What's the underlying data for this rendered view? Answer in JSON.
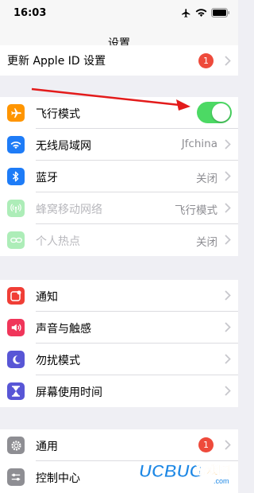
{
  "status_bar": {
    "time": "16:03"
  },
  "nav": {
    "title": "设置"
  },
  "top_item": {
    "label": "更新 Apple ID 设置",
    "badge": "1"
  },
  "group1": [
    {
      "id": "airplane",
      "label": "飞行模式",
      "value": "",
      "toggle_on": true,
      "icon": "airplane-icon",
      "color": "#ff9500",
      "disabled": false
    },
    {
      "id": "wifi",
      "label": "无线局域网",
      "value": "Jfchina",
      "icon": "wifi-icon",
      "color": "#1e7cf7",
      "disabled": false
    },
    {
      "id": "bluetooth",
      "label": "蓝牙",
      "value": "关闭",
      "icon": "bluetooth-icon",
      "color": "#1e7cf7",
      "disabled": false
    },
    {
      "id": "cellular",
      "label": "蜂窝移动网络",
      "value": "飞行模式",
      "icon": "cellular-icon",
      "color": "#4cd964",
      "disabled": true
    },
    {
      "id": "hotspot",
      "label": "个人热点",
      "value": "关闭",
      "icon": "hotspot-icon",
      "color": "#4cd964",
      "disabled": true
    }
  ],
  "group2": [
    {
      "id": "notifications",
      "label": "通知",
      "icon": "notifications-icon",
      "color": "#f03e36"
    },
    {
      "id": "sounds",
      "label": "声音与触感",
      "icon": "sounds-icon",
      "color": "#f0365a"
    },
    {
      "id": "dnd",
      "label": "勿扰模式",
      "icon": "moon-icon",
      "color": "#5856d6"
    },
    {
      "id": "screentime",
      "label": "屏幕使用时间",
      "icon": "hourglass-icon",
      "color": "#5856d6"
    }
  ],
  "group3": [
    {
      "id": "general",
      "label": "通用",
      "badge": "1",
      "icon": "gear-icon",
      "color": "#8e8e93"
    },
    {
      "id": "control",
      "label": "控制中心",
      "icon": "control-center-icon",
      "color": "#8e8e93"
    }
  ],
  "watermark": {
    "brand": "UCBUG",
    "text": "游戏网",
    "url": ".com"
  }
}
